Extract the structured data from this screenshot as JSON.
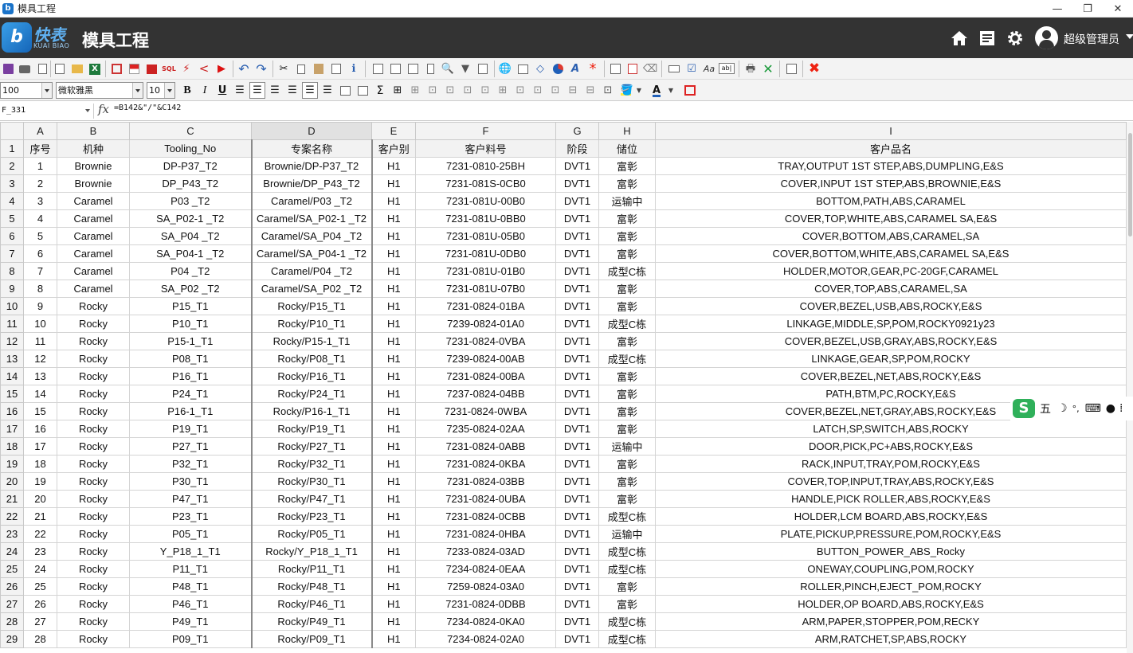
{
  "window": {
    "title": "模具工程",
    "controls": [
      "minimize-icon",
      "restore-icon",
      "close-icon"
    ]
  },
  "header": {
    "logo_cn": "快表",
    "logo_en": "KUAI BIAO",
    "logo_mark": "b",
    "app_title": "模具工程",
    "icons": [
      "home-icon",
      "list-icon",
      "gear-icon"
    ],
    "user_name": "超级管理员"
  },
  "toolbar": {
    "zoom": "100",
    "font_family": "微软雅黑",
    "font_size": "10",
    "bold": "B",
    "italic": "I",
    "underline": "U",
    "sum": "Σ",
    "font_color_letter": "A",
    "sql": "SQL",
    "aa": "Aa",
    "ab": "ab|"
  },
  "formula_bar": {
    "name_box": "F_331",
    "fx": "fx",
    "formula": "=B142&\"/\"&C142"
  },
  "columns": [
    "A",
    "B",
    "C",
    "D",
    "E",
    "F",
    "G",
    "H",
    "I"
  ],
  "header_row": [
    "序号",
    "机种",
    "Tooling_No",
    "专案名称",
    "客户别",
    "客户料号",
    "阶段",
    "储位",
    "客户品名"
  ],
  "rows": [
    [
      "1",
      "Brownie",
      "DP-P37_T2",
      "Brownie/DP-P37_T2",
      "H1",
      "7231-0810-25BH",
      "DVT1",
      "富彰",
      "TRAY,OUTPUT 1ST STEP,ABS,DUMPLING,E&S"
    ],
    [
      "2",
      "Brownie",
      "DP_P43_T2",
      "Brownie/DP_P43_T2",
      "H1",
      "7231-081S-0CB0",
      "DVT1",
      "富彰",
      "COVER,INPUT 1ST STEP,ABS,BROWNIE,E&S"
    ],
    [
      "3",
      "Caramel",
      "P03 _T2",
      "Caramel/P03 _T2",
      "H1",
      "7231-081U-00B0",
      "DVT1",
      "运输中",
      "BOTTOM,PATH,ABS,CARAMEL"
    ],
    [
      "4",
      "Caramel",
      "SA_P02-1 _T2",
      "Caramel/SA_P02-1 _T2",
      "H1",
      "7231-081U-0BB0",
      "DVT1",
      "富彰",
      "COVER,TOP,WHITE,ABS,CARAMEL SA,E&S"
    ],
    [
      "5",
      "Caramel",
      "SA_P04 _T2",
      "Caramel/SA_P04 _T2",
      "H1",
      "7231-081U-05B0",
      "DVT1",
      "富彰",
      "COVER,BOTTOM,ABS,CARAMEL,SA"
    ],
    [
      "6",
      "Caramel",
      "SA_P04-1 _T2",
      "Caramel/SA_P04-1 _T2",
      "H1",
      "7231-081U-0DB0",
      "DVT1",
      "富彰",
      "COVER,BOTTOM,WHITE,ABS,CARAMEL SA,E&S"
    ],
    [
      "7",
      "Caramel",
      "P04 _T2",
      "Caramel/P04 _T2",
      "H1",
      "7231-081U-01B0",
      "DVT1",
      "成型C栋",
      "HOLDER,MOTOR,GEAR,PC-20GF,CARAMEL"
    ],
    [
      "8",
      "Caramel",
      "SA_P02 _T2",
      "Caramel/SA_P02 _T2",
      "H1",
      "7231-081U-07B0",
      "DVT1",
      "富彰",
      "COVER,TOP,ABS,CARAMEL,SA"
    ],
    [
      "9",
      "Rocky",
      "P15_T1",
      "Rocky/P15_T1",
      "H1",
      "7231-0824-01BA",
      "DVT1",
      "富彰",
      "COVER,BEZEL,USB,ABS,ROCKY,E&S"
    ],
    [
      "10",
      "Rocky",
      "P10_T1",
      "Rocky/P10_T1",
      "H1",
      "7239-0824-01A0",
      "DVT1",
      "成型C栋",
      "LINKAGE,MIDDLE,SP,POM,ROCKY0921y23"
    ],
    [
      "11",
      "Rocky",
      "P15-1_T1",
      "Rocky/P15-1_T1",
      "H1",
      "7231-0824-0VBA",
      "DVT1",
      "富彰",
      "COVER,BEZEL,USB,GRAY,ABS,ROCKY,E&S"
    ],
    [
      "12",
      "Rocky",
      "P08_T1",
      "Rocky/P08_T1",
      "H1",
      "7239-0824-00AB",
      "DVT1",
      "成型C栋",
      "LINKAGE,GEAR,SP,POM,ROCKY"
    ],
    [
      "13",
      "Rocky",
      "P16_T1",
      "Rocky/P16_T1",
      "H1",
      "7231-0824-00BA",
      "DVT1",
      "富彰",
      "COVER,BEZEL,NET,ABS,ROCKY,E&S"
    ],
    [
      "14",
      "Rocky",
      "P24_T1",
      "Rocky/P24_T1",
      "H1",
      "7237-0824-04BB",
      "DVT1",
      "富彰",
      "PATH,BTM,PC,ROCKY,E&S"
    ],
    [
      "15",
      "Rocky",
      "P16-1_T1",
      "Rocky/P16-1_T1",
      "H1",
      "7231-0824-0WBA",
      "DVT1",
      "富彰",
      "COVER,BEZEL,NET,GRAY,ABS,ROCKY,E&S"
    ],
    [
      "16",
      "Rocky",
      "P19_T1",
      "Rocky/P19_T1",
      "H1",
      "7235-0824-02AA",
      "DVT1",
      "富彰",
      "LATCH,SP,SWITCH,ABS,ROCKY"
    ],
    [
      "17",
      "Rocky",
      "P27_T1",
      "Rocky/P27_T1",
      "H1",
      "7231-0824-0ABB",
      "DVT1",
      "运输中",
      "DOOR,PICK,PC+ABS,ROCKY,E&S"
    ],
    [
      "18",
      "Rocky",
      "P32_T1",
      "Rocky/P32_T1",
      "H1",
      "7231-0824-0KBA",
      "DVT1",
      "富彰",
      "RACK,INPUT,TRAY,POM,ROCKY,E&S"
    ],
    [
      "19",
      "Rocky",
      "P30_T1",
      "Rocky/P30_T1",
      "H1",
      "7231-0824-03BB",
      "DVT1",
      "富彰",
      "COVER,TOP,INPUT,TRAY,ABS,ROCKY,E&S"
    ],
    [
      "20",
      "Rocky",
      "P47_T1",
      "Rocky/P47_T1",
      "H1",
      "7231-0824-0UBA",
      "DVT1",
      "富彰",
      "HANDLE,PICK ROLLER,ABS,ROCKY,E&S"
    ],
    [
      "21",
      "Rocky",
      "P23_T1",
      "Rocky/P23_T1",
      "H1",
      "7231-0824-0CBB",
      "DVT1",
      "成型C栋",
      "HOLDER,LCM BOARD,ABS,ROCKY,E&S"
    ],
    [
      "22",
      "Rocky",
      "P05_T1",
      "Rocky/P05_T1",
      "H1",
      "7231-0824-0HBA",
      "DVT1",
      "运输中",
      "PLATE,PICKUP,PRESSURE,POM,ROCKY,E&S"
    ],
    [
      "23",
      "Rocky",
      "Y_P18_1_T1",
      "Rocky/Y_P18_1_T1",
      "H1",
      "7233-0824-03AD",
      "DVT1",
      "成型C栋",
      "BUTTON_POWER_ABS_Rocky"
    ],
    [
      "24",
      "Rocky",
      "P11_T1",
      "Rocky/P11_T1",
      "H1",
      "7234-0824-0EAA",
      "DVT1",
      "成型C栋",
      "ONEWAY,COUPLING,POM,ROCKY"
    ],
    [
      "25",
      "Rocky",
      "P48_T1",
      "Rocky/P48_T1",
      "H1",
      "7259-0824-03A0",
      "DVT1",
      "富彰",
      "ROLLER,PINCH,EJECT_POM,ROCKY"
    ],
    [
      "26",
      "Rocky",
      "P46_T1",
      "Rocky/P46_T1",
      "H1",
      "7231-0824-0DBB",
      "DVT1",
      "富彰",
      "HOLDER,OP BOARD,ABS,ROCKY,E&S"
    ],
    [
      "27",
      "Rocky",
      "P49_T1",
      "Rocky/P49_T1",
      "H1",
      "7234-0824-0KA0",
      "DVT1",
      "成型C栋",
      "ARM,PAPER,STOPPER,POM,RECKY"
    ],
    [
      "28",
      "Rocky",
      "P09_T1",
      "Rocky/P09_T1",
      "H1",
      "7234-0824-02A0",
      "DVT1",
      "成型C栋",
      "ARM,RATCHET,SP,ABS,ROCKY"
    ]
  ],
  "ime": {
    "logo": "S",
    "mode": "五"
  },
  "colors": {
    "header_bg": "#333333",
    "selected_col_border": "#8a8a8a",
    "grid_border": "#d4d4d4"
  }
}
